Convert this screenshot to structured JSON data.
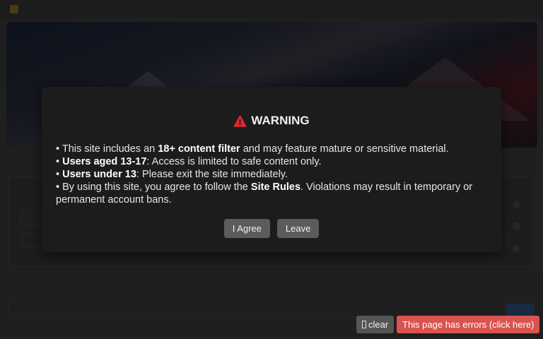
{
  "modal": {
    "title": "WARNING",
    "icon": "warning-triangle-icon",
    "icon_color": "#e0262f",
    "lines": [
      {
        "pre": "This site includes an ",
        "bold": "18+ content filter",
        "post": " and may feature mature or sensitive material."
      },
      {
        "pre": "",
        "bold": "Users aged 13-17",
        "post": ": Access is limited to safe content only."
      },
      {
        "pre": "",
        "bold": "Users under 13",
        "post": ": Please exit the site immediately."
      },
      {
        "pre": "By using this site, you agree to follow the ",
        "bold": "Site Rules",
        "post": ". Violations may result in temporary or permanent account bans."
      }
    ],
    "bullet": "•",
    "agree_label": "I Agree",
    "leave_label": "Leave"
  },
  "error_bar": {
    "clear_label": "clear",
    "message": "This page has errors (click here)",
    "message_color": "#d9534f"
  }
}
